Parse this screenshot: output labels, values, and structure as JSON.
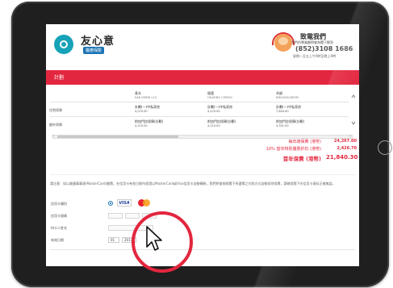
{
  "header": {
    "brand_name": "友心意",
    "brand_badge": "醫療保險",
    "call_title": "致電我們",
    "call_note": "我們的專業顧問會為閣下解答",
    "call_phone": "(852)3108 1686",
    "call_hours": "星期一至五上午9時至晚上9時"
  },
  "section_title": "計劃",
  "plans": {
    "columns": [
      {
        "name": "基本",
        "code": "KAN KMEW L10"
      },
      {
        "name": "優選",
        "code": "OK-KONG CSP000"
      },
      {
        "name": "卓越",
        "code": "KMK-KOKLDEEM"
      }
    ],
    "rows": [
      {
        "label": "住院保障",
        "cells": [
          {
            "title": "計劃(一)中私家房",
            "value": "4,070.00"
          },
          {
            "title": "計劃(一)中私家房",
            "value": "4,470.00"
          },
          {
            "title": "計劃(一)中私家房",
            "value": "7,604.00"
          }
        ]
      },
      {
        "label": "額外保障",
        "cells": [
          {
            "title": "附加門診保障(計劃)",
            "value": "4,210.00"
          },
          {
            "title": "附加門診保障(計劃)",
            "value": "4,210.00"
          },
          {
            "title": "附加門診保障(計劃)",
            "value": "4,301.00"
          }
        ]
      }
    ]
  },
  "totals": {
    "annual_label": "每年總保費 (港幣)",
    "annual_value": "24,267.00",
    "discount_label": "10% 首年特別優惠折扣 (港幣)",
    "discount_value": "2,426.70",
    "final_label": "首年保費 (港幣)",
    "final_value": "21,840.30"
  },
  "note": "請注意：如以美國萬事達(MasterCard)繳費，在信用卡有效日期內保證以MasterCard或Visa信用卡自動轉賬，我們將會按照閣下所選擇之付款方式自動扣除保費，請確保閣下的信用卡資料正確無誤。",
  "form": {
    "card_type_label": "信用卡類別",
    "card_number_label": "信用卡號碼",
    "holder_label": "持卡人姓名",
    "expiry_label": "有效日期",
    "visa_label": "VISA",
    "month_value": "01",
    "year_value": "2017"
  }
}
